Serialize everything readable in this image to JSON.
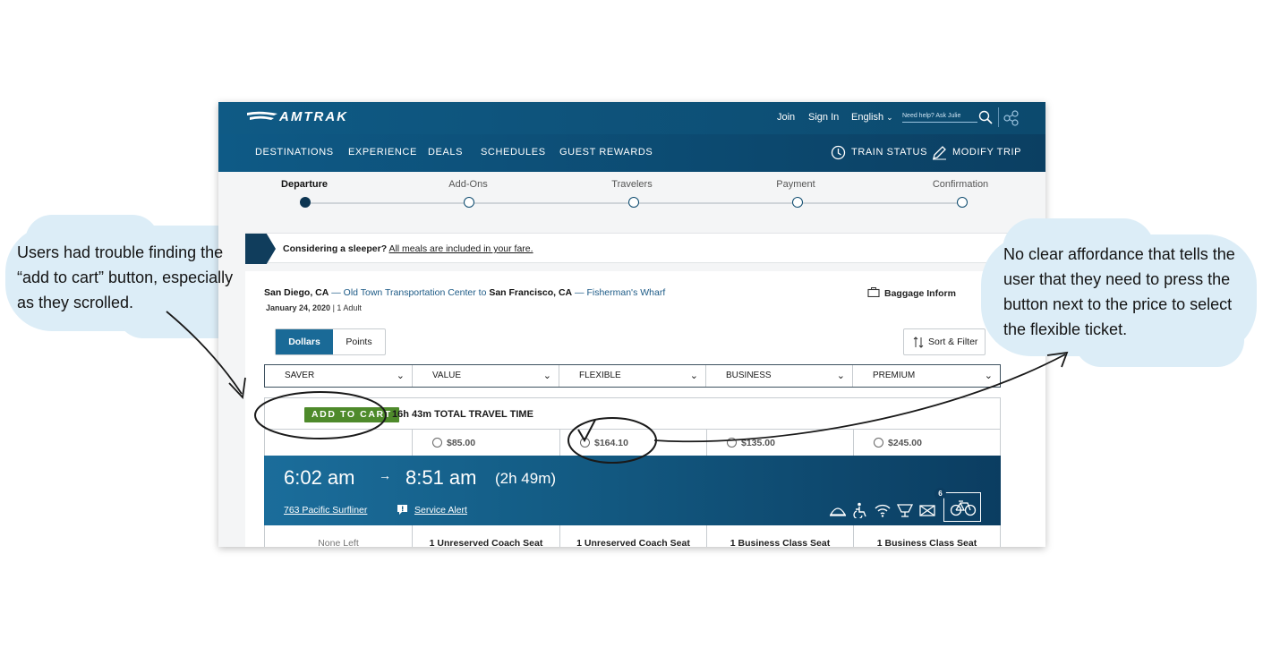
{
  "header": {
    "brand": "AMTRAK",
    "join": "Join",
    "sign_in": "Sign In",
    "language": "English",
    "search_placeholder": "Need help? Ask Julie"
  },
  "nav": {
    "items": [
      "DESTINATIONS",
      "EXPERIENCE",
      "DEALS",
      "SCHEDULES",
      "GUEST REWARDS"
    ],
    "train_status": "TRAIN STATUS",
    "modify_trip": "MODIFY TRIP"
  },
  "progress": {
    "steps": [
      "Departure",
      "Add-Ons",
      "Travelers",
      "Payment",
      "Confirmation"
    ]
  },
  "banner": {
    "lead": "Considering a sleeper?",
    "link": "All meals are included in your fare."
  },
  "trip": {
    "origin_city": "San Diego, CA",
    "origin_station": "— Old Town Transportation Center to",
    "dest_city": "San Francisco, CA",
    "dest_station": "— Fisherman's Wharf",
    "date": "January 24, 2020",
    "travelers": "1 Adult",
    "baggage": "Baggage Inform"
  },
  "currency_toggle": {
    "dollars": "Dollars",
    "points": "Points"
  },
  "sort_filter": "Sort & Filter",
  "fare_classes": [
    "SAVER",
    "VALUE",
    "FLEXIBLE",
    "BUSINESS",
    "PREMIUM"
  ],
  "add_to_cart": "ADD TO CART",
  "total_travel_time": "16h 43m TOTAL TRAVEL TIME",
  "prices": [
    "$85.00",
    "$164.10",
    "$135.00",
    "$245.00"
  ],
  "segment": {
    "depart": "6:02 am",
    "arrow": "→",
    "arrive": "8:51 am",
    "duration": "(2h 49m)",
    "train": "763 Pacific Surfliner",
    "alert": "Service Alert",
    "bike_count": "6",
    "seats": [
      "None Left",
      "1 Unreserved Coach Seat",
      "1 Unreserved Coach Seat",
      "1 Business Class Seat",
      "1 Business Class Seat"
    ]
  },
  "amenity_icons": [
    "quiet-car-icon",
    "accessible-icon",
    "wifi-icon",
    "cafe-icon",
    "no-smoking-icon",
    "bike-icon"
  ],
  "annotations": {
    "left_lines": [
      "Users had trouble finding the",
      "“add to cart” button, especially",
      "as they scrolled."
    ],
    "right_lines": [
      "No clear affordance that tells the",
      "user that they need to press the",
      "button next to the price to select",
      "the flexible ticket."
    ]
  },
  "colors": {
    "brand_blue": "#0c4a6e",
    "cart_green": "#4e8a2b",
    "cloud": "#dcedf7"
  }
}
